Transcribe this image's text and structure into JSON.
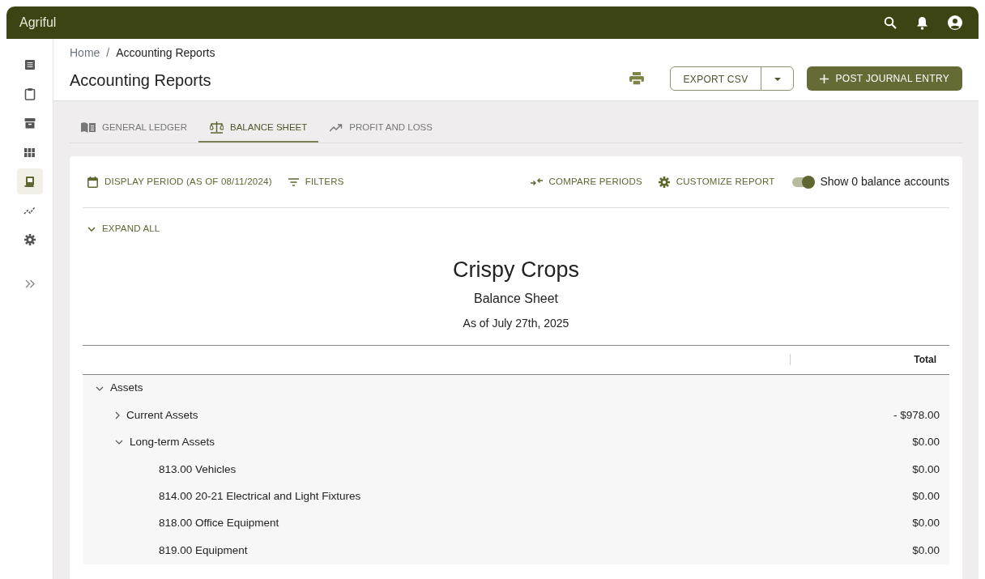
{
  "app": {
    "logo": "Agriful"
  },
  "sidebar": {
    "items": [
      {
        "selected": false
      },
      {
        "selected": false
      },
      {
        "selected": false
      },
      {
        "selected": false
      },
      {
        "selected": true
      },
      {
        "selected": false
      },
      {
        "selected": false
      }
    ]
  },
  "breadcrumb": [
    "Home",
    "Accounting Reports"
  ],
  "breadcrumb_separator": "/",
  "page_title": "Accounting Reports",
  "actions": {
    "export": "EXPORT CSV",
    "post": "POST JOURNAL ENTRY"
  },
  "tabs": [
    {
      "label": "GENERAL LEDGER",
      "selected": false
    },
    {
      "label": "BALANCE SHEET",
      "selected": true
    },
    {
      "label": "PROFIT AND LOSS",
      "selected": false
    }
  ],
  "toolbar": {
    "display_period": "DISPLAY PERIOD (AS OF 08/11/2024)",
    "filters": "FILTERS",
    "compare": "COMPARE PERIODS",
    "customize": "CUSTOMIZE REPORT",
    "toggle": {
      "label": "Show 0 balance accounts",
      "on": true
    }
  },
  "expand_all": "EXPAND ALL",
  "report": {
    "company": "Crispy Crops",
    "title": "Balance Sheet",
    "date": "As of July 27th, 2025"
  },
  "table": {
    "columns": [
      "Total"
    ],
    "rows": [
      {
        "label": "Assets",
        "expanded": true,
        "children": [
          {
            "label": "Current Assets",
            "total": "- $978.00",
            "expanded": false
          },
          {
            "label": "Long-term Assets",
            "total": "$0.00",
            "expanded": true,
            "children": [
              {
                "label": "813.00 Vehicles",
                "total": "$0.00"
              },
              {
                "label": "814.00 20-21 Electrical and Light Fixtures",
                "total": "$0.00"
              },
              {
                "label": "818.00 Office Equipment",
                "total": "$0.00"
              },
              {
                "label": "819.00 Equipment",
                "total": "$0.00"
              }
            ]
          }
        ]
      }
    ]
  }
}
